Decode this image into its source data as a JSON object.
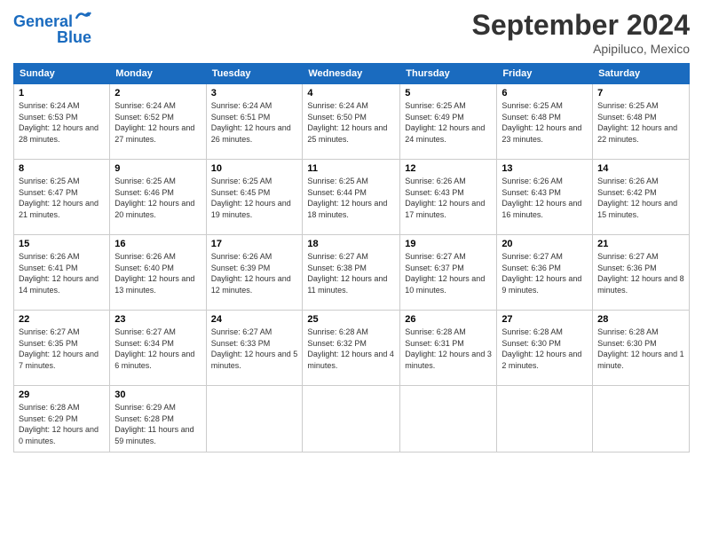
{
  "header": {
    "logo_line1": "General",
    "logo_line2": "Blue",
    "month": "September 2024",
    "location": "Apipiluco, Mexico"
  },
  "weekdays": [
    "Sunday",
    "Monday",
    "Tuesday",
    "Wednesday",
    "Thursday",
    "Friday",
    "Saturday"
  ],
  "weeks": [
    [
      {
        "day": "1",
        "sunrise": "Sunrise: 6:24 AM",
        "sunset": "Sunset: 6:53 PM",
        "daylight": "Daylight: 12 hours and 28 minutes."
      },
      {
        "day": "2",
        "sunrise": "Sunrise: 6:24 AM",
        "sunset": "Sunset: 6:52 PM",
        "daylight": "Daylight: 12 hours and 27 minutes."
      },
      {
        "day": "3",
        "sunrise": "Sunrise: 6:24 AM",
        "sunset": "Sunset: 6:51 PM",
        "daylight": "Daylight: 12 hours and 26 minutes."
      },
      {
        "day": "4",
        "sunrise": "Sunrise: 6:24 AM",
        "sunset": "Sunset: 6:50 PM",
        "daylight": "Daylight: 12 hours and 25 minutes."
      },
      {
        "day": "5",
        "sunrise": "Sunrise: 6:25 AM",
        "sunset": "Sunset: 6:49 PM",
        "daylight": "Daylight: 12 hours and 24 minutes."
      },
      {
        "day": "6",
        "sunrise": "Sunrise: 6:25 AM",
        "sunset": "Sunset: 6:48 PM",
        "daylight": "Daylight: 12 hours and 23 minutes."
      },
      {
        "day": "7",
        "sunrise": "Sunrise: 6:25 AM",
        "sunset": "Sunset: 6:48 PM",
        "daylight": "Daylight: 12 hours and 22 minutes."
      }
    ],
    [
      {
        "day": "8",
        "sunrise": "Sunrise: 6:25 AM",
        "sunset": "Sunset: 6:47 PM",
        "daylight": "Daylight: 12 hours and 21 minutes."
      },
      {
        "day": "9",
        "sunrise": "Sunrise: 6:25 AM",
        "sunset": "Sunset: 6:46 PM",
        "daylight": "Daylight: 12 hours and 20 minutes."
      },
      {
        "day": "10",
        "sunrise": "Sunrise: 6:25 AM",
        "sunset": "Sunset: 6:45 PM",
        "daylight": "Daylight: 12 hours and 19 minutes."
      },
      {
        "day": "11",
        "sunrise": "Sunrise: 6:25 AM",
        "sunset": "Sunset: 6:44 PM",
        "daylight": "Daylight: 12 hours and 18 minutes."
      },
      {
        "day": "12",
        "sunrise": "Sunrise: 6:26 AM",
        "sunset": "Sunset: 6:43 PM",
        "daylight": "Daylight: 12 hours and 17 minutes."
      },
      {
        "day": "13",
        "sunrise": "Sunrise: 6:26 AM",
        "sunset": "Sunset: 6:43 PM",
        "daylight": "Daylight: 12 hours and 16 minutes."
      },
      {
        "day": "14",
        "sunrise": "Sunrise: 6:26 AM",
        "sunset": "Sunset: 6:42 PM",
        "daylight": "Daylight: 12 hours and 15 minutes."
      }
    ],
    [
      {
        "day": "15",
        "sunrise": "Sunrise: 6:26 AM",
        "sunset": "Sunset: 6:41 PM",
        "daylight": "Daylight: 12 hours and 14 minutes."
      },
      {
        "day": "16",
        "sunrise": "Sunrise: 6:26 AM",
        "sunset": "Sunset: 6:40 PM",
        "daylight": "Daylight: 12 hours and 13 minutes."
      },
      {
        "day": "17",
        "sunrise": "Sunrise: 6:26 AM",
        "sunset": "Sunset: 6:39 PM",
        "daylight": "Daylight: 12 hours and 12 minutes."
      },
      {
        "day": "18",
        "sunrise": "Sunrise: 6:27 AM",
        "sunset": "Sunset: 6:38 PM",
        "daylight": "Daylight: 12 hours and 11 minutes."
      },
      {
        "day": "19",
        "sunrise": "Sunrise: 6:27 AM",
        "sunset": "Sunset: 6:37 PM",
        "daylight": "Daylight: 12 hours and 10 minutes."
      },
      {
        "day": "20",
        "sunrise": "Sunrise: 6:27 AM",
        "sunset": "Sunset: 6:36 PM",
        "daylight": "Daylight: 12 hours and 9 minutes."
      },
      {
        "day": "21",
        "sunrise": "Sunrise: 6:27 AM",
        "sunset": "Sunset: 6:36 PM",
        "daylight": "Daylight: 12 hours and 8 minutes."
      }
    ],
    [
      {
        "day": "22",
        "sunrise": "Sunrise: 6:27 AM",
        "sunset": "Sunset: 6:35 PM",
        "daylight": "Daylight: 12 hours and 7 minutes."
      },
      {
        "day": "23",
        "sunrise": "Sunrise: 6:27 AM",
        "sunset": "Sunset: 6:34 PM",
        "daylight": "Daylight: 12 hours and 6 minutes."
      },
      {
        "day": "24",
        "sunrise": "Sunrise: 6:27 AM",
        "sunset": "Sunset: 6:33 PM",
        "daylight": "Daylight: 12 hours and 5 minutes."
      },
      {
        "day": "25",
        "sunrise": "Sunrise: 6:28 AM",
        "sunset": "Sunset: 6:32 PM",
        "daylight": "Daylight: 12 hours and 4 minutes."
      },
      {
        "day": "26",
        "sunrise": "Sunrise: 6:28 AM",
        "sunset": "Sunset: 6:31 PM",
        "daylight": "Daylight: 12 hours and 3 minutes."
      },
      {
        "day": "27",
        "sunrise": "Sunrise: 6:28 AM",
        "sunset": "Sunset: 6:30 PM",
        "daylight": "Daylight: 12 hours and 2 minutes."
      },
      {
        "day": "28",
        "sunrise": "Sunrise: 6:28 AM",
        "sunset": "Sunset: 6:30 PM",
        "daylight": "Daylight: 12 hours and 1 minute."
      }
    ],
    [
      {
        "day": "29",
        "sunrise": "Sunrise: 6:28 AM",
        "sunset": "Sunset: 6:29 PM",
        "daylight": "Daylight: 12 hours and 0 minutes."
      },
      {
        "day": "30",
        "sunrise": "Sunrise: 6:29 AM",
        "sunset": "Sunset: 6:28 PM",
        "daylight": "Daylight: 11 hours and 59 minutes."
      },
      null,
      null,
      null,
      null,
      null
    ]
  ]
}
